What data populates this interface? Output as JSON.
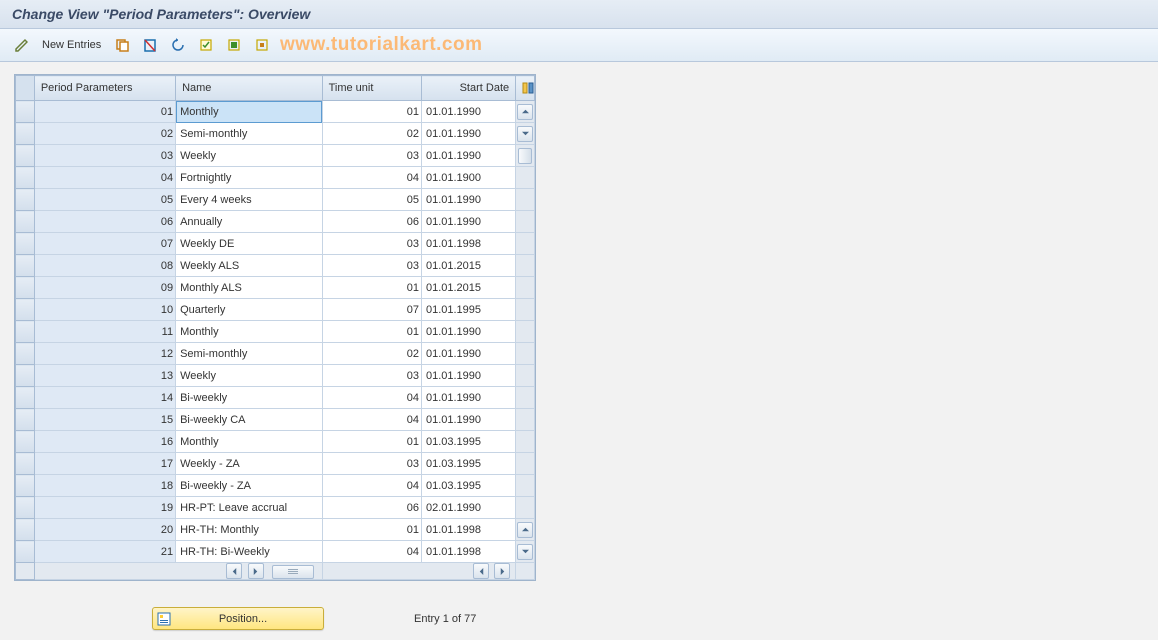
{
  "title": "Change View \"Period Parameters\": Overview",
  "watermark": "www.tutorialkart.com",
  "toolbar": {
    "new_entries_label": "New Entries"
  },
  "footer": {
    "position_label": "Position...",
    "entry_label": "Entry 1 of 77"
  },
  "table": {
    "columns": {
      "period_params": "Period Parameters",
      "name": "Name",
      "time_unit": "Time unit",
      "start_date": "Start Date"
    },
    "rows": [
      {
        "pp": "01",
        "name": "Monthly",
        "tu": "01",
        "sd": "01.01.1990",
        "selected": true
      },
      {
        "pp": "02",
        "name": "Semi-monthly",
        "tu": "02",
        "sd": "01.01.1990"
      },
      {
        "pp": "03",
        "name": "Weekly",
        "tu": "03",
        "sd": "01.01.1990"
      },
      {
        "pp": "04",
        "name": "Fortnightly",
        "tu": "04",
        "sd": "01.01.1900"
      },
      {
        "pp": "05",
        "name": "Every 4 weeks",
        "tu": "05",
        "sd": "01.01.1990"
      },
      {
        "pp": "06",
        "name": "Annually",
        "tu": "06",
        "sd": "01.01.1990"
      },
      {
        "pp": "07",
        "name": "Weekly  DE",
        "tu": "03",
        "sd": "01.01.1998"
      },
      {
        "pp": "08",
        "name": "Weekly ALS",
        "tu": "03",
        "sd": "01.01.2015"
      },
      {
        "pp": "09",
        "name": "Monthly ALS",
        "tu": "01",
        "sd": "01.01.2015"
      },
      {
        "pp": "10",
        "name": "Quarterly",
        "tu": "07",
        "sd": "01.01.1995"
      },
      {
        "pp": "11",
        "name": "Monthly",
        "tu": "01",
        "sd": "01.01.1990"
      },
      {
        "pp": "12",
        "name": "Semi-monthly",
        "tu": "02",
        "sd": "01.01.1990"
      },
      {
        "pp": "13",
        "name": "Weekly",
        "tu": "03",
        "sd": "01.01.1990"
      },
      {
        "pp": "14",
        "name": "Bi-weekly",
        "tu": "04",
        "sd": "01.01.1990"
      },
      {
        "pp": "15",
        "name": "Bi-weekly CA",
        "tu": "04",
        "sd": "01.01.1990"
      },
      {
        "pp": "16",
        "name": "Monthly",
        "tu": "01",
        "sd": "01.03.1995"
      },
      {
        "pp": "17",
        "name": "Weekly - ZA",
        "tu": "03",
        "sd": "01.03.1995"
      },
      {
        "pp": "18",
        "name": "Bi-weekly - ZA",
        "tu": "04",
        "sd": "01.03.1995"
      },
      {
        "pp": "19",
        "name": "HR-PT: Leave accrual",
        "tu": "06",
        "sd": "02.01.1990"
      },
      {
        "pp": "20",
        "name": "HR-TH: Monthly",
        "tu": "01",
        "sd": "01.01.1998"
      },
      {
        "pp": "21",
        "name": "HR-TH: Bi-Weekly",
        "tu": "04",
        "sd": "01.01.1998"
      }
    ]
  }
}
